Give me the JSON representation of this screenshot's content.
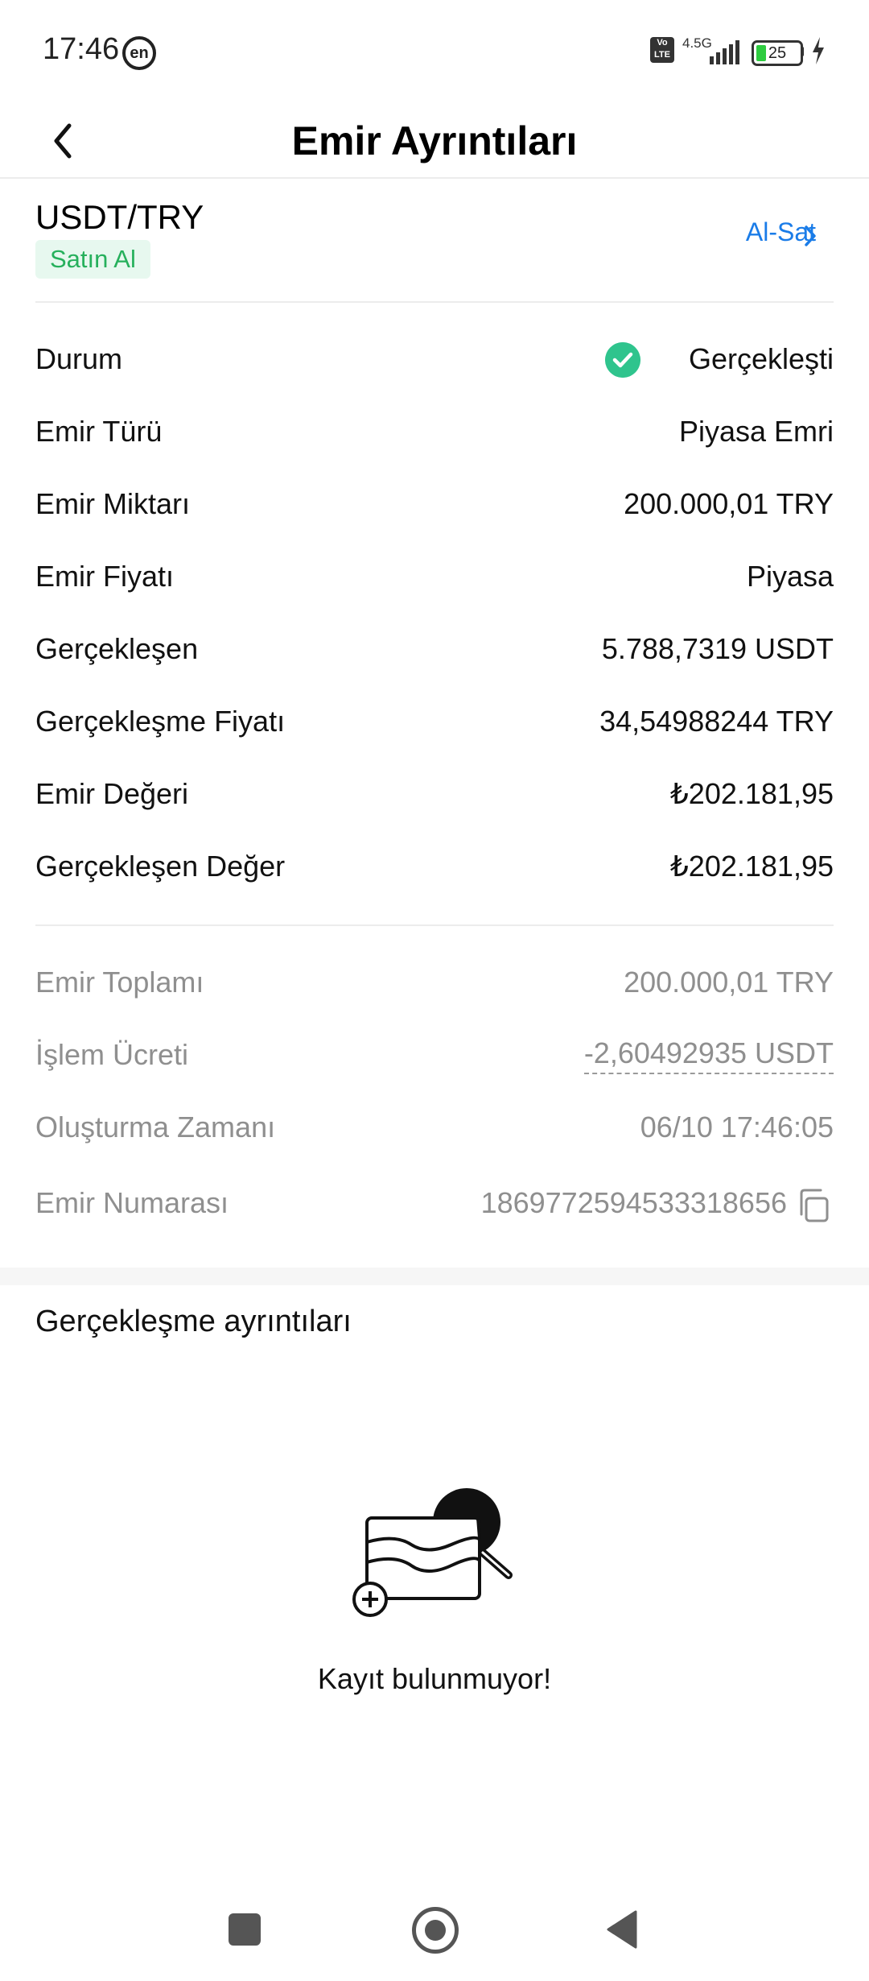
{
  "status_bar": {
    "time": "17:46",
    "lang_badge": "en",
    "volte": "Vo LTE",
    "network": "4.5G",
    "battery": "25"
  },
  "header": {
    "title": "Emir Ayrıntıları"
  },
  "pair": {
    "symbol": "USDT/TRY",
    "side": "Satın Al",
    "trade_link": "Al-Sat"
  },
  "details": [
    {
      "label": "Durum",
      "value": "Gerçekleşti"
    },
    {
      "label": "Emir Türü",
      "value": "Piyasa Emri"
    },
    {
      "label": "Emir Miktarı",
      "value": "200.000,01 TRY"
    },
    {
      "label": "Emir Fiyatı",
      "value": "Piyasa"
    },
    {
      "label": "Gerçekleşen",
      "value": "5.788,7319 USDT"
    },
    {
      "label": "Gerçekleşme Fiyatı",
      "value": "34,54988244 TRY"
    },
    {
      "label": "Emir Değeri",
      "value": "₺202.181,95"
    },
    {
      "label": "Gerçekleşen Değer",
      "value": "₺202.181,95"
    }
  ],
  "summary": [
    {
      "label": "Emir Toplamı",
      "value": "200.000,01 TRY"
    },
    {
      "label": "İşlem Ücreti",
      "value": "-2,60492935 USDT"
    },
    {
      "label": "Oluşturma Zamanı",
      "value": "06/10 17:46:05"
    },
    {
      "label": "Emir Numarası",
      "value": "1869772594533318656"
    }
  ],
  "execution": {
    "title": "Gerçekleşme ayrıntıları",
    "empty_text": "Kayıt bulunmuyor!"
  },
  "colors": {
    "success": "#2fc48d",
    "link": "#1a7ce8",
    "badge_bg": "#e7f8ef",
    "badge_text": "#26b05c",
    "muted": "#8f8f8f"
  },
  "icons": [
    "back-arrow-icon",
    "chevron-right-icon",
    "check-circle-icon",
    "copy-icon",
    "empty-search-icon"
  ]
}
